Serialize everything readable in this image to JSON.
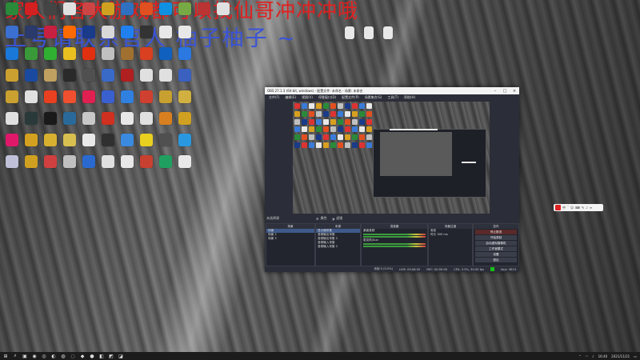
{
  "banner": {
    "line1": "家人们各大游戏都可以找仙哥冲冲冲哦",
    "line2": "上号请联系官人 柚子柚子 ~"
  },
  "desktop_icons": [
    {
      "label": "",
      "color": "#2a8a3a"
    },
    {
      "label": "",
      "color": "#d32020"
    },
    {
      "label": "",
      "color": "#444"
    },
    {
      "label": "",
      "color": "#e0e0e0"
    },
    {
      "label": "",
      "color": "#c44"
    },
    {
      "label": "",
      "color": "#d0a020"
    },
    {
      "label": "",
      "color": "#3070c0"
    },
    {
      "label": "",
      "color": "#e05020"
    },
    {
      "label": "",
      "color": "#1090e0"
    },
    {
      "label": "",
      "color": "#7a4"
    },
    {
      "label": "",
      "color": "#b33"
    },
    {
      "label": "",
      "color": "#e0e0e0"
    },
    {
      "label": "",
      "color": "#3b6fd0"
    },
    {
      "label": "",
      "color": "#2a3a6a"
    },
    {
      "label": "",
      "color": "#c82040"
    },
    {
      "label": "",
      "color": "#ff6a00"
    },
    {
      "label": "",
      "color": "#1a3a8a"
    },
    {
      "label": "",
      "color": "#d8d8d8"
    },
    {
      "label": "",
      "color": "#2080f0"
    },
    {
      "label": "",
      "color": "#333"
    },
    {
      "label": "",
      "color": "#e8e8e8"
    },
    {
      "label": "",
      "color": "#e8e8e8"
    },
    {
      "label": "",
      "color": "#1a78d8"
    },
    {
      "label": "",
      "color": "#3a9a3a"
    },
    {
      "label": "",
      "color": "#30b030"
    },
    {
      "label": "",
      "color": "#e8c020"
    },
    {
      "label": "",
      "color": "#e03010"
    },
    {
      "label": "",
      "color": "#c0c0c0"
    },
    {
      "label": "",
      "color": "#a07030"
    },
    {
      "label": "",
      "color": "#d84020"
    },
    {
      "label": "",
      "color": "#1060c0"
    },
    {
      "label": "",
      "color": "#2a78e0"
    },
    {
      "label": "",
      "color": "#caa030"
    },
    {
      "label": "",
      "color": "#1a4aa0"
    },
    {
      "label": "",
      "color": "#c0a060"
    },
    {
      "label": "",
      "color": "#2a2a2a"
    },
    {
      "label": "",
      "color": "#505050"
    },
    {
      "label": "",
      "color": "#3a6ac8"
    },
    {
      "label": "",
      "color": "#b02020"
    },
    {
      "label": "",
      "color": "#e0e0e0"
    },
    {
      "label": "",
      "color": "#e0e0e0"
    },
    {
      "label": "",
      "color": "#3a60c0"
    },
    {
      "label": "",
      "color": "#caa030"
    },
    {
      "label": "",
      "color": "#e0e0e0"
    },
    {
      "label": "",
      "color": "#e84020"
    },
    {
      "label": "",
      "color": "#f05030"
    },
    {
      "label": "",
      "color": "#e02050"
    },
    {
      "label": "",
      "color": "#3a60d0"
    },
    {
      "label": "",
      "color": "#3080e0"
    },
    {
      "label": "",
      "color": "#d04030"
    },
    {
      "label": "",
      "color": "#c8a030"
    },
    {
      "label": "",
      "color": "#d0b040"
    },
    {
      "label": "",
      "color": "#e0e0e0"
    },
    {
      "label": "",
      "color": "#2a3a3a"
    },
    {
      "label": "",
      "color": "#1a1a1a"
    },
    {
      "label": "",
      "color": "#2a6a9a"
    },
    {
      "label": "",
      "color": "#c8c8c8"
    },
    {
      "label": "",
      "color": "#d03020"
    },
    {
      "label": "",
      "color": "#e8e8e8"
    },
    {
      "label": "",
      "color": "#e0e0e0"
    },
    {
      "label": "",
      "color": "#d88020"
    },
    {
      "label": "",
      "color": "#d0a020"
    },
    {
      "label": "",
      "color": "#e0186a"
    },
    {
      "label": "",
      "color": "#d4a020"
    },
    {
      "label": "",
      "color": "#d8b030"
    },
    {
      "label": "",
      "color": "#d8c050"
    },
    {
      "label": "",
      "color": "#e8e8e8"
    },
    {
      "label": "",
      "color": "#303030"
    },
    {
      "label": "",
      "color": "#3a8ae0"
    },
    {
      "label": "",
      "color": "#e8d020"
    },
    {
      "label": "",
      "color": "#505050"
    },
    {
      "label": "",
      "color": "#2a98e0"
    },
    {
      "label": "",
      "color": "#c0c0d8"
    },
    {
      "label": "",
      "color": "#d0a020"
    },
    {
      "label": "",
      "color": "#d04040"
    },
    {
      "label": "",
      "color": "#c0c0c0"
    },
    {
      "label": "",
      "color": "#2a6ad0"
    },
    {
      "label": "",
      "color": "#e0e0e0"
    },
    {
      "label": "",
      "color": "#e8e8e8"
    },
    {
      "label": "",
      "color": "#c84030"
    },
    {
      "label": "",
      "color": "#20a060"
    },
    {
      "label": "",
      "color": "#e8e8e8"
    }
  ],
  "right_icons": [
    {
      "color": "#e8e8e8"
    },
    {
      "color": "#e8e8e8"
    },
    {
      "color": "#e8e8e8"
    }
  ],
  "obs": {
    "title": "OBS 27.1.3 (64-bit, windows) - 配置文件: 未命名 - 场景: 未命名",
    "menu": [
      "文件(F)",
      "编辑(E)",
      "视图(V)",
      "停靠窗口(D)",
      "配置文件(P)",
      "场景集合(S)",
      "工具(T)",
      "帮助(H)"
    ],
    "panel_bar": {
      "left": "未选择源",
      "props": "属性",
      "filters": "滤镜"
    },
    "docks": {
      "scenes": {
        "title": "场景",
        "items": [
          "场景",
          "场景 2",
          "场景 3"
        ]
      },
      "sources": {
        "title": "来源",
        "items": [
          "显示器采集",
          "音频输出采集",
          "音频输出采集 2",
          "音频输入采集",
          "音频输入采集 2"
        ]
      },
      "mixer": {
        "title": "混音器",
        "items": [
          "桌面音频",
          "麦克风/Aux"
        ]
      },
      "transitions": {
        "title": "场景过渡",
        "items": [
          "渐变",
          "时长 300 ms"
        ]
      },
      "controls": {
        "title": "控件",
        "buttons": [
          "停止推流",
          "开始录制",
          "启动虚拟摄像机",
          "工作室模式",
          "设置",
          "退出"
        ]
      }
    },
    "status": {
      "dropped": "丢帧 0 (0.0%)",
      "live": "LIVE: 00:06:35",
      "rec": "REC: 00:00:00",
      "cpu": "CPU: 3.5%, 30.00 fps",
      "kbps": "kb/s: 3619"
    }
  },
  "floatbar": {
    "items": [
      "中",
      "ˇ",
      "☺",
      "⌨",
      "✎",
      "♪",
      "≡"
    ]
  },
  "taskbar": {
    "tray_time": "16:40",
    "tray_date": "2021/11/21",
    "items": [
      "⊞",
      "⌕",
      "▣",
      "◉",
      "◎",
      "◐",
      "◍",
      "◌",
      "◆",
      "●",
      "◧",
      "◩",
      "◪"
    ]
  }
}
